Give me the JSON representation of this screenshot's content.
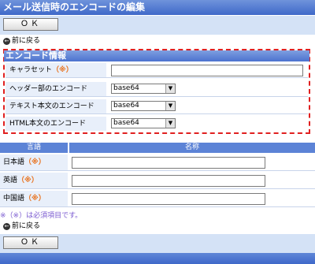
{
  "title": "メール送信時のエンコードの編集",
  "ok_label": "ＯＫ",
  "back_label": "前に戻る",
  "section_title": "エンコード情報",
  "required_mark": "（※）",
  "charset": {
    "label": "キャラセット",
    "value": ""
  },
  "header_encoding": {
    "label": "ヘッダー部のエンコード",
    "value": "base64"
  },
  "text_encoding": {
    "label": "テキスト本文のエンコード",
    "value": "base64"
  },
  "html_encoding": {
    "label": "HTML本文のエンコード",
    "value": "base64"
  },
  "lang_table": {
    "col_language": "言語",
    "col_name": "名称",
    "rows": [
      {
        "label": "日本語",
        "value": ""
      },
      {
        "label": "英語",
        "value": ""
      },
      {
        "label": "中国語",
        "value": ""
      }
    ]
  },
  "required_note": "※（※）は必須項目です。",
  "dropdown_arrow": "▼",
  "back_icon": "←"
}
